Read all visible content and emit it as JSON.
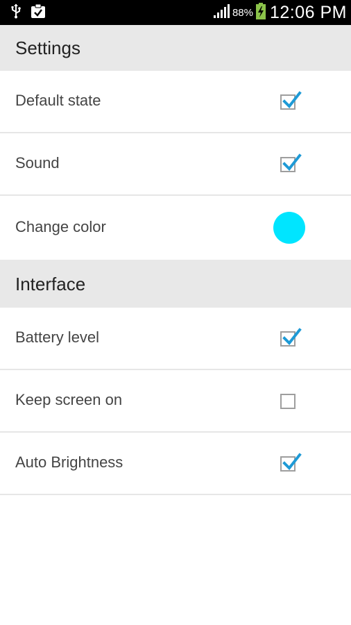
{
  "status_bar": {
    "battery_percent": "88%",
    "time": "12:06 PM",
    "icons": [
      "usb-icon",
      "clipboard-icon",
      "signal-icon",
      "battery-charging-icon"
    ]
  },
  "sections": {
    "settings": {
      "title": "Settings"
    },
    "interface": {
      "title": "Interface"
    }
  },
  "settings_items": {
    "default_state": {
      "label": "Default state",
      "checked": true
    },
    "sound": {
      "label": "Sound",
      "checked": true
    },
    "change_color": {
      "label": "Change color",
      "color": "#00e5ff"
    }
  },
  "interface_items": {
    "battery_level": {
      "label": "Battery level",
      "checked": true
    },
    "keep_screen_on": {
      "label": "Keep screen on",
      "checked": false
    },
    "auto_brightness": {
      "label": "Auto Brightness",
      "checked": true
    }
  },
  "colors": {
    "checkmark": "#1e9ad6",
    "header_bg": "#e8e8e8",
    "status_bar_bg": "#000000"
  }
}
